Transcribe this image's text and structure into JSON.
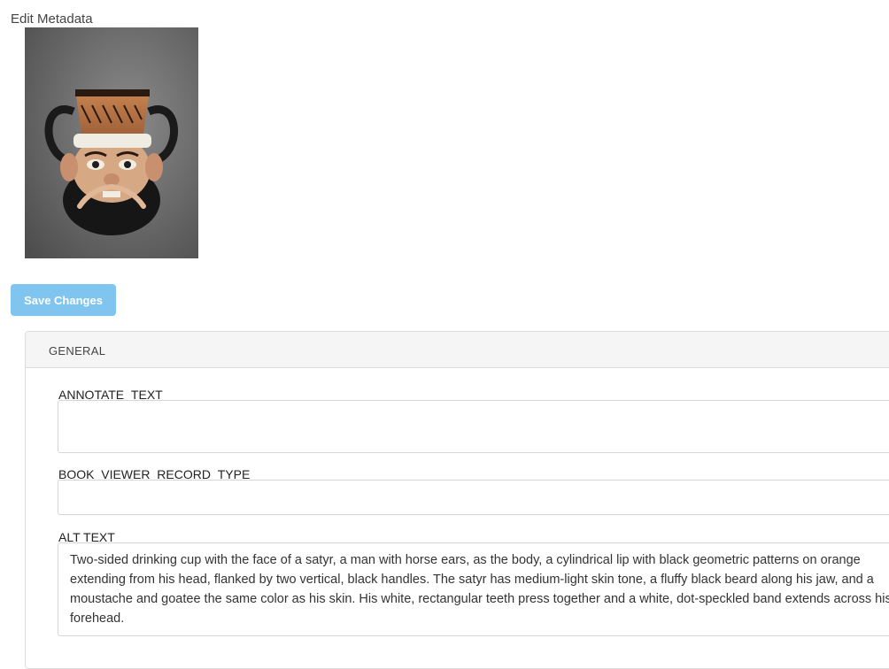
{
  "header": {
    "title": "Edit Metadata"
  },
  "toolbar": {
    "save_label": "Save Changes"
  },
  "panel": {
    "heading": "GENERAL",
    "fields": [
      {
        "label": "ANNOTATE_TEXT",
        "value": ""
      },
      {
        "label": "BOOK_VIEWER_RECORD_TYPE",
        "value": ""
      },
      {
        "label": "ALT TEXT",
        "value": "Two-sided drinking cup with the face of a satyr, a man with horse ears, as the body, a cylindrical lip with black geometric patterns on orange extending from his head, flanked by two vertical, black handles. The satyr has medium-light skin tone, a fluffy black beard along his jaw, and a moustache and goatee the same color as his skin. His white, rectangular teeth press together and a white, dot-speckled band extends across his forehead."
      }
    ]
  },
  "colors": {
    "save_button_bg": "#7fc5ef",
    "panel_heading_bg": "#f5f5f5",
    "border": "#dcdcdc"
  }
}
